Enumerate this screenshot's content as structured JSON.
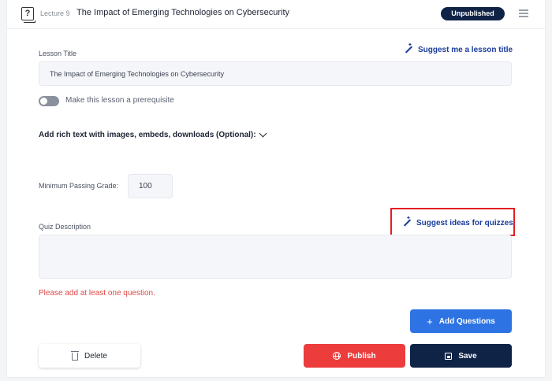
{
  "header": {
    "lecture_label": "Lecture 9",
    "lesson_title": "The Impact of Emerging Technologies on Cybersecurity",
    "status_badge": "Unpublished"
  },
  "form": {
    "lesson_title_label": "Lesson Title",
    "suggest_title_link": "Suggest me a lesson title",
    "lesson_title_value": "The Impact of Emerging Technologies on Cybersecurity",
    "prerequisite_label": "Make this lesson a prerequisite",
    "prerequisite_enabled": false,
    "rich_text_label": "Add rich text with images, embeds, downloads (Optional):",
    "min_grade_label": "Minimum Passing Grade:",
    "min_grade_value": "100",
    "quiz_description_label": "Quiz Description",
    "suggest_quiz_link": "Suggest ideas for quizzes",
    "quiz_description_value": "",
    "error_message": "Please add at least one question."
  },
  "actions": {
    "add_questions": "Add Questions",
    "delete": "Delete",
    "publish": "Publish",
    "save": "Save"
  },
  "colors": {
    "primary_navy": "#0f2347",
    "link_blue": "#1a3d9c",
    "add_blue": "#2d73e3",
    "publish_red": "#ec3c3c",
    "error_red": "#e04848",
    "highlight_red": "#e31e24"
  },
  "icons": [
    "quiz-icon",
    "menu-icon",
    "wand-icon",
    "chevron-down-icon",
    "plus-icon",
    "trash-icon",
    "globe-icon",
    "save-icon"
  ]
}
